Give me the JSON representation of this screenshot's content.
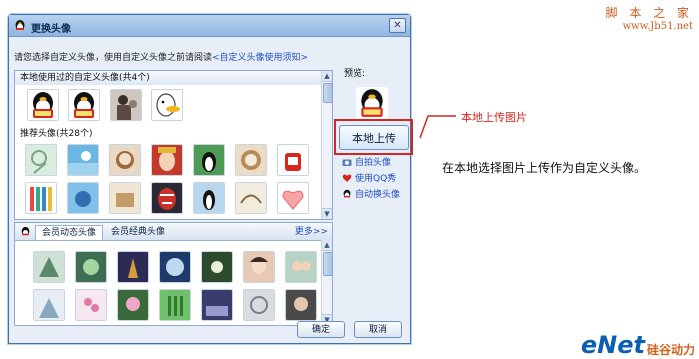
{
  "watermark_top": {
    "line1": "脚 本 之 家",
    "line2": "www.Jb51.net"
  },
  "watermark_bottom": {
    "brand": "eNet",
    "cn": "硅谷动力"
  },
  "dialog": {
    "title": "更换头像",
    "close_glyph": "✕",
    "hint": "请您选择自定义头像，使用自定义头像之前请阅读",
    "hint_link": "<自定义头像使用须知>",
    "recent_header": "本地使用过的自定义头像(共4个)",
    "recommended_header": "推荐头像(共28个)",
    "preview_label": "预览:",
    "upload_button": "本地上传",
    "side_links": [
      "自拍头像",
      "使用QQ秀",
      "自动换头像"
    ],
    "tabs": [
      "会员动态头像",
      "会员经典头像"
    ],
    "more_link": "更多>>",
    "ok": "确定",
    "cancel": "取消"
  },
  "callout": "本地上传图片",
  "caption": "在本地选择图片上传作为自定义头像。",
  "colors": {
    "accent_red": "#d8261f",
    "link_blue": "#1e4fc0",
    "title_bar": "#8fb5e2"
  }
}
